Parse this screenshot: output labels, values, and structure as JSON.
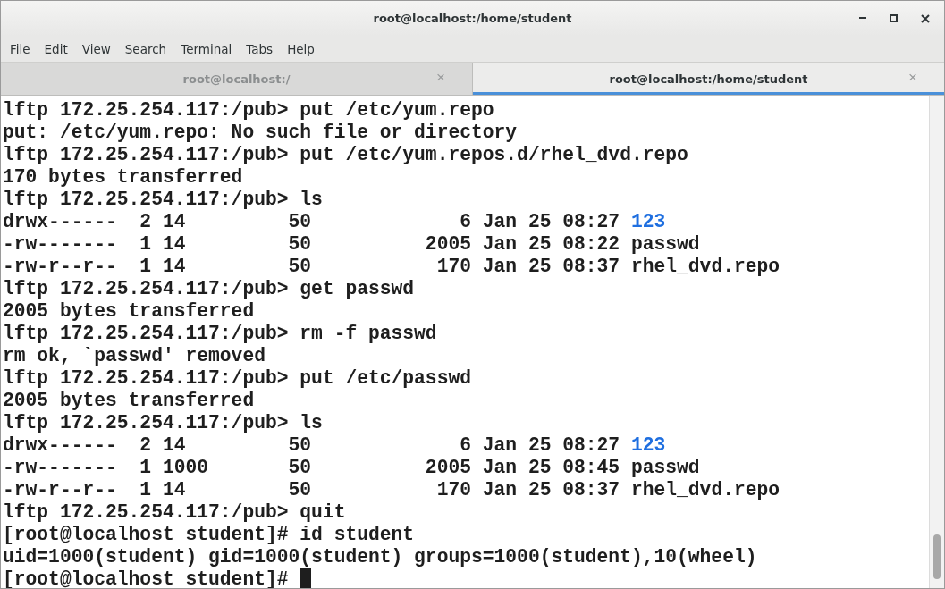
{
  "window": {
    "title": "root@localhost:/home/student"
  },
  "menu": [
    "File",
    "Edit",
    "View",
    "Search",
    "Terminal",
    "Tabs",
    "Help"
  ],
  "tabs": [
    {
      "label": "root@localhost:/",
      "selected": false,
      "close": "×"
    },
    {
      "label": "root@localhost:/home/student",
      "selected": true,
      "close": "×"
    }
  ],
  "terminal": {
    "lines": [
      {
        "kind": "text",
        "text": "lftp 172.25.254.117:/pub> put /etc/yum.repo"
      },
      {
        "kind": "text",
        "text": "put: /etc/yum.repo: No such file or directory"
      },
      {
        "kind": "text",
        "text": "lftp 172.25.254.117:/pub> put /etc/yum.repos.d/rhel_dvd.repo"
      },
      {
        "kind": "text",
        "text": "170 bytes transferred"
      },
      {
        "kind": "text",
        "text": "lftp 172.25.254.117:/pub> ls"
      },
      {
        "kind": "listing",
        "info": "drwx------  2 14         50             6 Jan 25 08:27",
        "name": "123",
        "directory": true
      },
      {
        "kind": "listing",
        "info": "-rw-------  1 14         50          2005 Jan 25 08:22",
        "name": "passwd",
        "directory": false
      },
      {
        "kind": "listing",
        "info": "-rw-r--r--  1 14         50           170 Jan 25 08:37",
        "name": "rhel_dvd.repo",
        "directory": false
      },
      {
        "kind": "text",
        "text": "lftp 172.25.254.117:/pub> get passwd"
      },
      {
        "kind": "text",
        "text": "2005 bytes transferred"
      },
      {
        "kind": "text",
        "text": "lftp 172.25.254.117:/pub> rm -f passwd"
      },
      {
        "kind": "text",
        "text": "rm ok, `passwd' removed"
      },
      {
        "kind": "text",
        "text": "lftp 172.25.254.117:/pub> put /etc/passwd"
      },
      {
        "kind": "text",
        "text": "2005 bytes transferred"
      },
      {
        "kind": "text",
        "text": "lftp 172.25.254.117:/pub> ls"
      },
      {
        "kind": "listing",
        "info": "drwx------  2 14         50             6 Jan 25 08:27",
        "name": "123",
        "directory": true
      },
      {
        "kind": "listing",
        "info": "-rw-------  1 1000       50          2005 Jan 25 08:45",
        "name": "passwd",
        "directory": false
      },
      {
        "kind": "listing",
        "info": "-rw-r--r--  1 14         50           170 Jan 25 08:37",
        "name": "rhel_dvd.repo",
        "directory": false
      },
      {
        "kind": "text",
        "text": "lftp 172.25.254.117:/pub> quit"
      },
      {
        "kind": "text",
        "text": "[root@localhost student]# id student"
      },
      {
        "kind": "text",
        "text": "uid=1000(student) gid=1000(student) groups=1000(student),10(wheel)"
      },
      {
        "kind": "prompt",
        "text": "[root@localhost student]#"
      }
    ]
  }
}
